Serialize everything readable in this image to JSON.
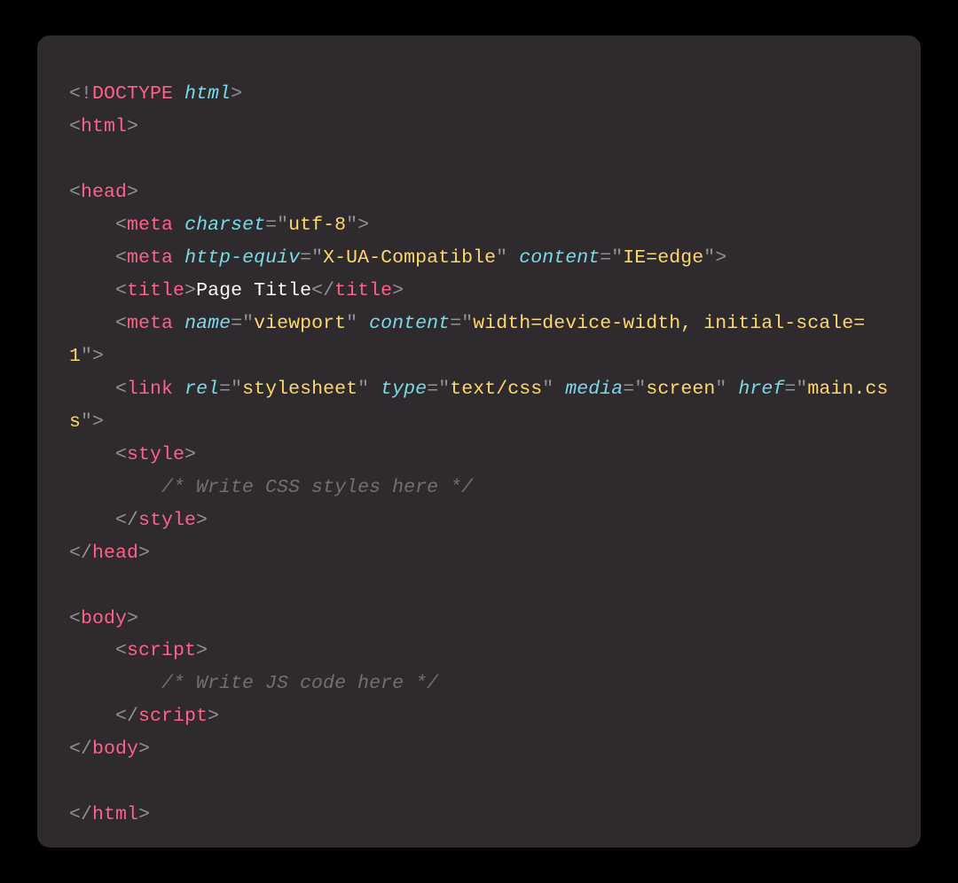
{
  "code": {
    "doctype_kw": "DOCTYPE",
    "doctype_val": "html",
    "tags": {
      "html": "html",
      "head": "head",
      "meta": "meta",
      "title": "title",
      "link": "link",
      "style": "style",
      "body": "body",
      "script": "script"
    },
    "attrs": {
      "charset": "charset",
      "http_equiv": "http-equiv",
      "content": "content",
      "name": "name",
      "rel": "rel",
      "type": "type",
      "media": "media",
      "href": "href"
    },
    "values": {
      "utf8": "utf-8",
      "xua": "X-UA-Compatible",
      "ieedge": "IE=edge",
      "viewport": "viewport",
      "vp_content": "width=device-width, initial-scale=1",
      "stylesheet": "stylesheet",
      "textcss": "text/css",
      "screen": "screen",
      "maincss": "main.css"
    },
    "text": {
      "page_title": "Page Title"
    },
    "comments": {
      "css": "/* Write CSS styles here */",
      "js": "/* Write JS code here */"
    }
  }
}
